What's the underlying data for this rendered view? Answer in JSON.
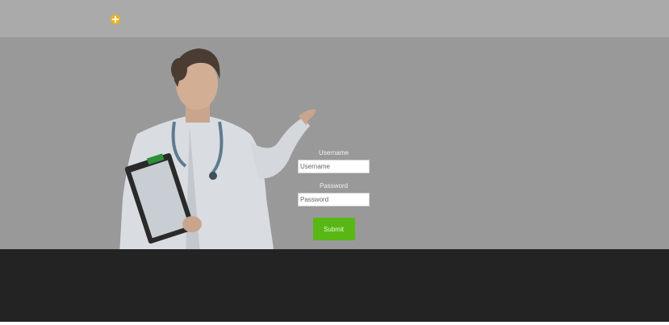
{
  "header": {
    "logo_text": "",
    "logo_icon": "medical-cross-icon",
    "bar_color": "#aaaaaa",
    "brand_color": "#43c21f"
  },
  "hero": {
    "background_color": "#999999",
    "image": "doctor-holding-clipboard"
  },
  "login_form": {
    "username_label": "Username",
    "username_placeholder": "Username",
    "password_label": "Password",
    "password_placeholder": "Password",
    "submit_label": "Submit",
    "button_color": "#58b714"
  },
  "footer": {
    "background_color": "#232323"
  }
}
